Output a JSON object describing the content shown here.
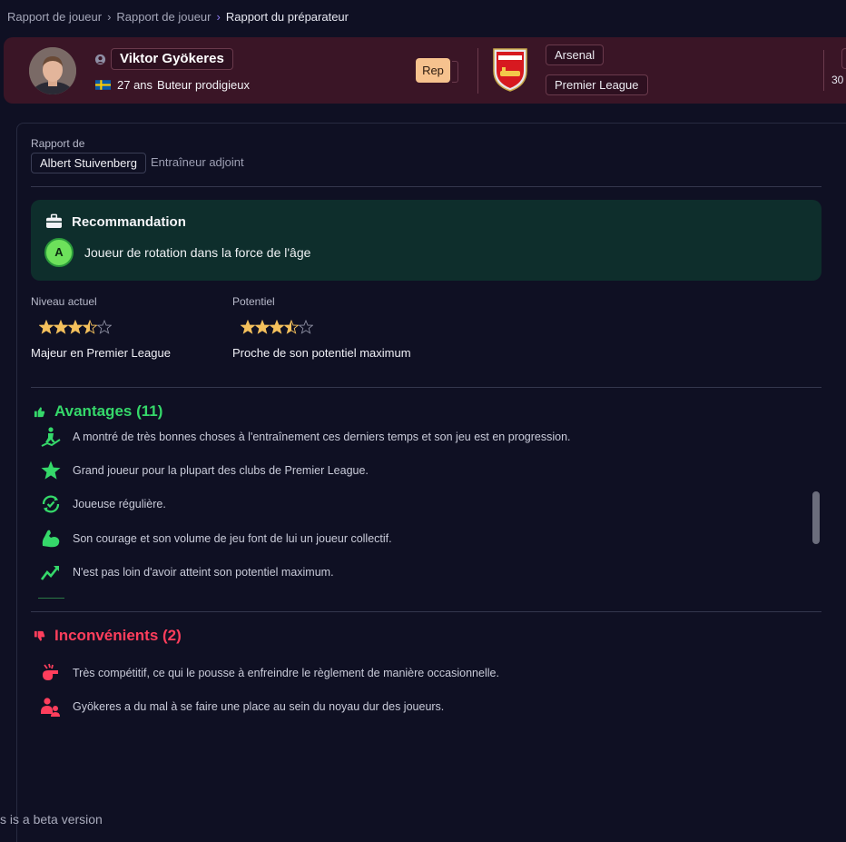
{
  "breadcrumb": {
    "items": [
      "Rapport de joueur",
      "Rapport de joueur",
      "Rapport du préparateur"
    ]
  },
  "player": {
    "name": "Viktor Gyökeres",
    "age": "27 ans",
    "profile": "Buteur prodigieux",
    "nationality_flag": "sweden-flag"
  },
  "header": {
    "rep_label": "Rep",
    "club": "Arsenal",
    "league": "Premier League",
    "right_value": "30"
  },
  "report": {
    "label": "Rapport de",
    "scout_name": "Albert Stuivenberg",
    "scout_role": "Entraîneur adjoint"
  },
  "recommendation": {
    "title": "Recommandation",
    "grade": "A",
    "text": "Joueur de rotation dans la force de l'âge"
  },
  "ratings": {
    "current": {
      "label": "Niveau actuel",
      "stars": 3.5,
      "max": 5,
      "description": "Majeur en Premier League"
    },
    "potential": {
      "label": "Potentiel",
      "stars": 3.5,
      "max": 5,
      "description": "Proche de son potentiel maximum"
    }
  },
  "pros": {
    "title": "Avantages (11)",
    "items": [
      {
        "icon": "training-progress-icon",
        "text": "A montré de très bonnes choses à l'entraînement ces derniers temps et son jeu est en progression."
      },
      {
        "icon": "star-icon",
        "text": "Grand joueur pour la plupart des clubs de Premier League."
      },
      {
        "icon": "consistency-icon",
        "text": "Joueuse régulière."
      },
      {
        "icon": "muscle-icon",
        "text": "Son courage et son volume de jeu font de lui un joueur collectif."
      },
      {
        "icon": "trend-up-icon",
        "text": "N'est pas loin d'avoir atteint son potentiel maximum."
      }
    ]
  },
  "cons": {
    "title": "Inconvénients (2)",
    "items": [
      {
        "icon": "whistle-icon",
        "text": "Très compétitif, ce qui le pousse à enfreindre le règlement de manière occasionnelle."
      },
      {
        "icon": "group-icon",
        "text": "Gyökeres a du mal à se faire une place au sein du noyau dur des joueurs."
      }
    ]
  },
  "footer": {
    "beta_text": "s is a beta version"
  },
  "colors": {
    "background": "#0f1023",
    "header_bg": "#3a1526",
    "recommend_bg": "#0e2e2c",
    "pros": "#35d86a",
    "cons": "#ff3e5c",
    "star": "#f4c05c",
    "rep_button": "#f6c28e"
  }
}
